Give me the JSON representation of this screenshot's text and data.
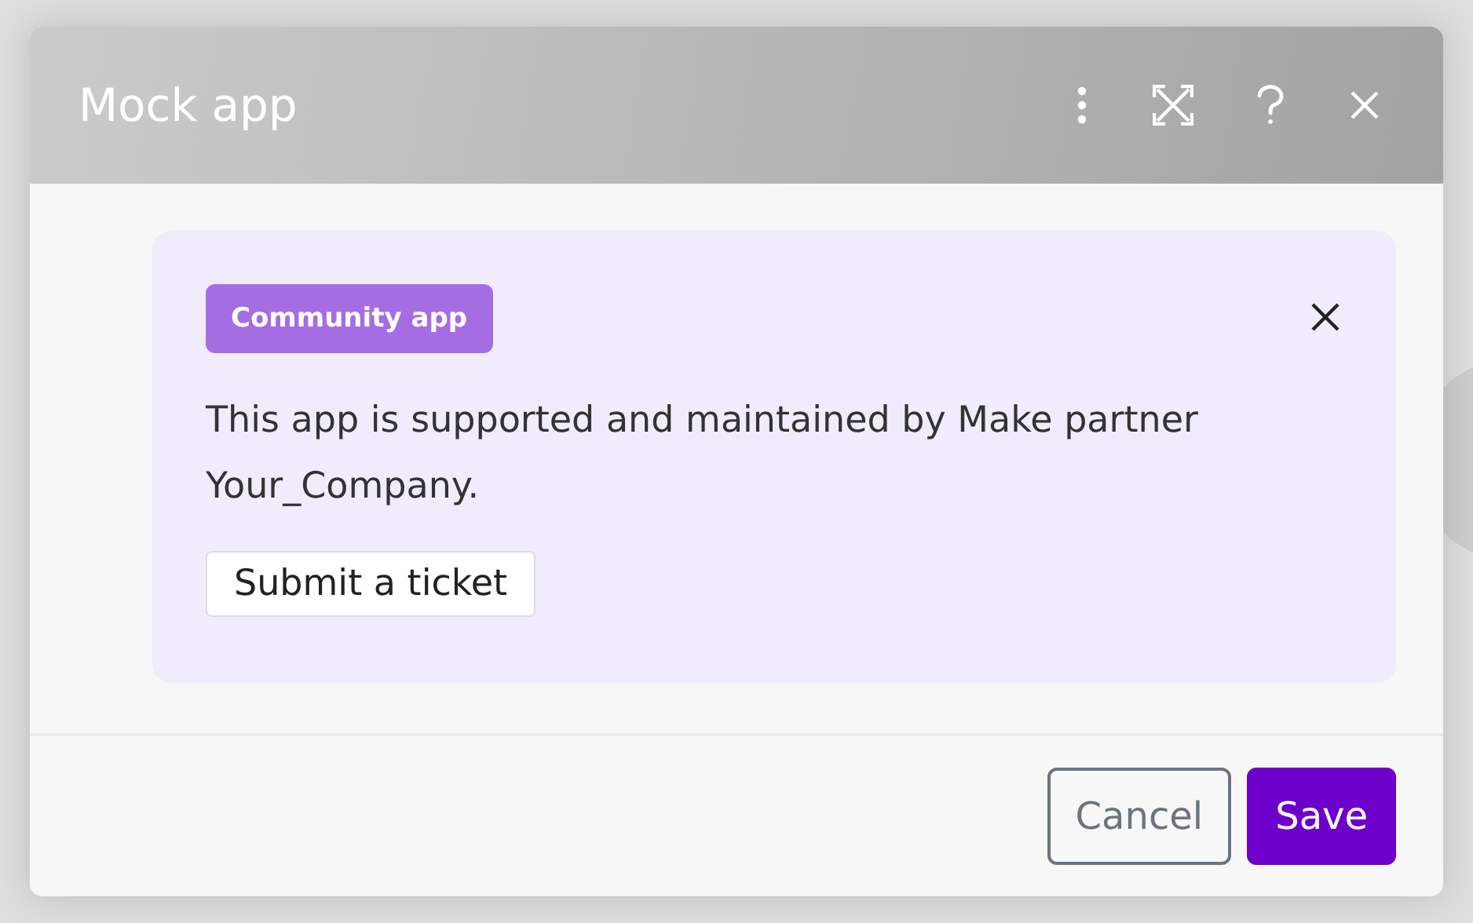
{
  "window": {
    "title": "Mock app",
    "header_icons": [
      {
        "kind": "menu"
      },
      {
        "kind": "expand"
      },
      {
        "kind": "help"
      },
      {
        "kind": "close"
      }
    ]
  },
  "notice": {
    "badge": "Community app",
    "message": "This app is supported and maintained by Make partner Your_Company.",
    "action": "Submit a ticket"
  },
  "buttons": [
    {
      "label": "Cancel",
      "kind": "secondary"
    },
    {
      "label": "Save",
      "kind": "primary"
    }
  ]
}
